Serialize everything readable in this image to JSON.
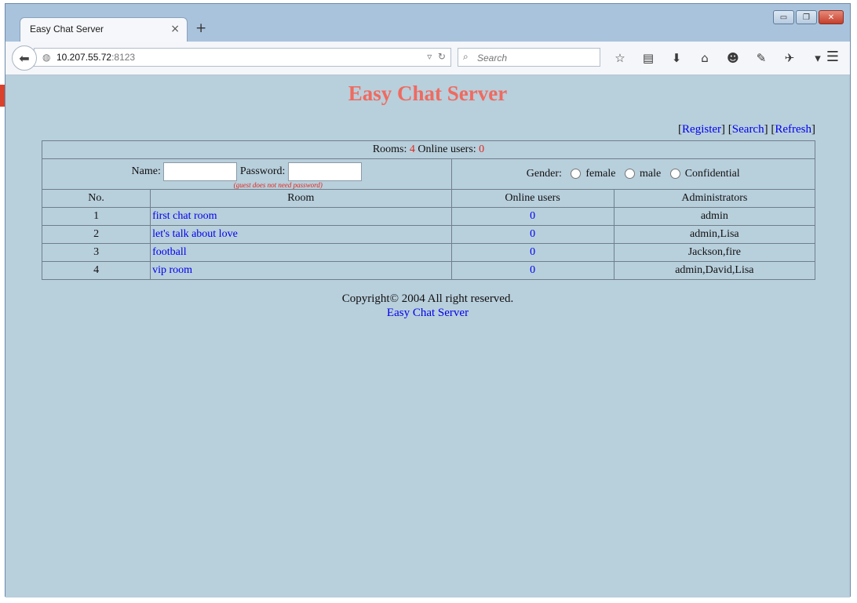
{
  "browser": {
    "tab_title": "Easy Chat Server",
    "tab_close": "×",
    "new_tab": "+",
    "url_host": "10.207.55.72",
    "url_port": ":8123",
    "search_placeholder": "Search",
    "window_controls": {
      "minimize": "▭",
      "maximize": "❐",
      "close": "✕"
    }
  },
  "page": {
    "title": "Easy Chat Server",
    "links": {
      "register": "Register",
      "search": "Search",
      "refresh": "Refresh"
    },
    "stats": {
      "rooms_label": "Rooms:",
      "rooms_value": "4",
      "online_label": "Online users:",
      "online_value": "0"
    },
    "login": {
      "name_label": "Name:",
      "password_label": "Password:",
      "hint": "(guest does not need password)",
      "gender_label": "Gender:",
      "gender_options": [
        "female",
        "male",
        "Confidential"
      ]
    },
    "columns": [
      "No.",
      "Room",
      "Online users",
      "Administrators"
    ],
    "rooms": [
      {
        "no": "1",
        "room": "first chat room",
        "online": "0",
        "admins": "admin"
      },
      {
        "no": "2",
        "room": "let's talk about love",
        "online": "0",
        "admins": "admin,Lisa"
      },
      {
        "no": "3",
        "room": "football",
        "online": "0",
        "admins": "Jackson,fire"
      },
      {
        "no": "4",
        "room": "vip room",
        "online": "0",
        "admins": "admin,David,Lisa"
      }
    ],
    "footer": {
      "copyright": "Copyright© 2004 All right reserved.",
      "link": "Easy Chat Server"
    }
  }
}
